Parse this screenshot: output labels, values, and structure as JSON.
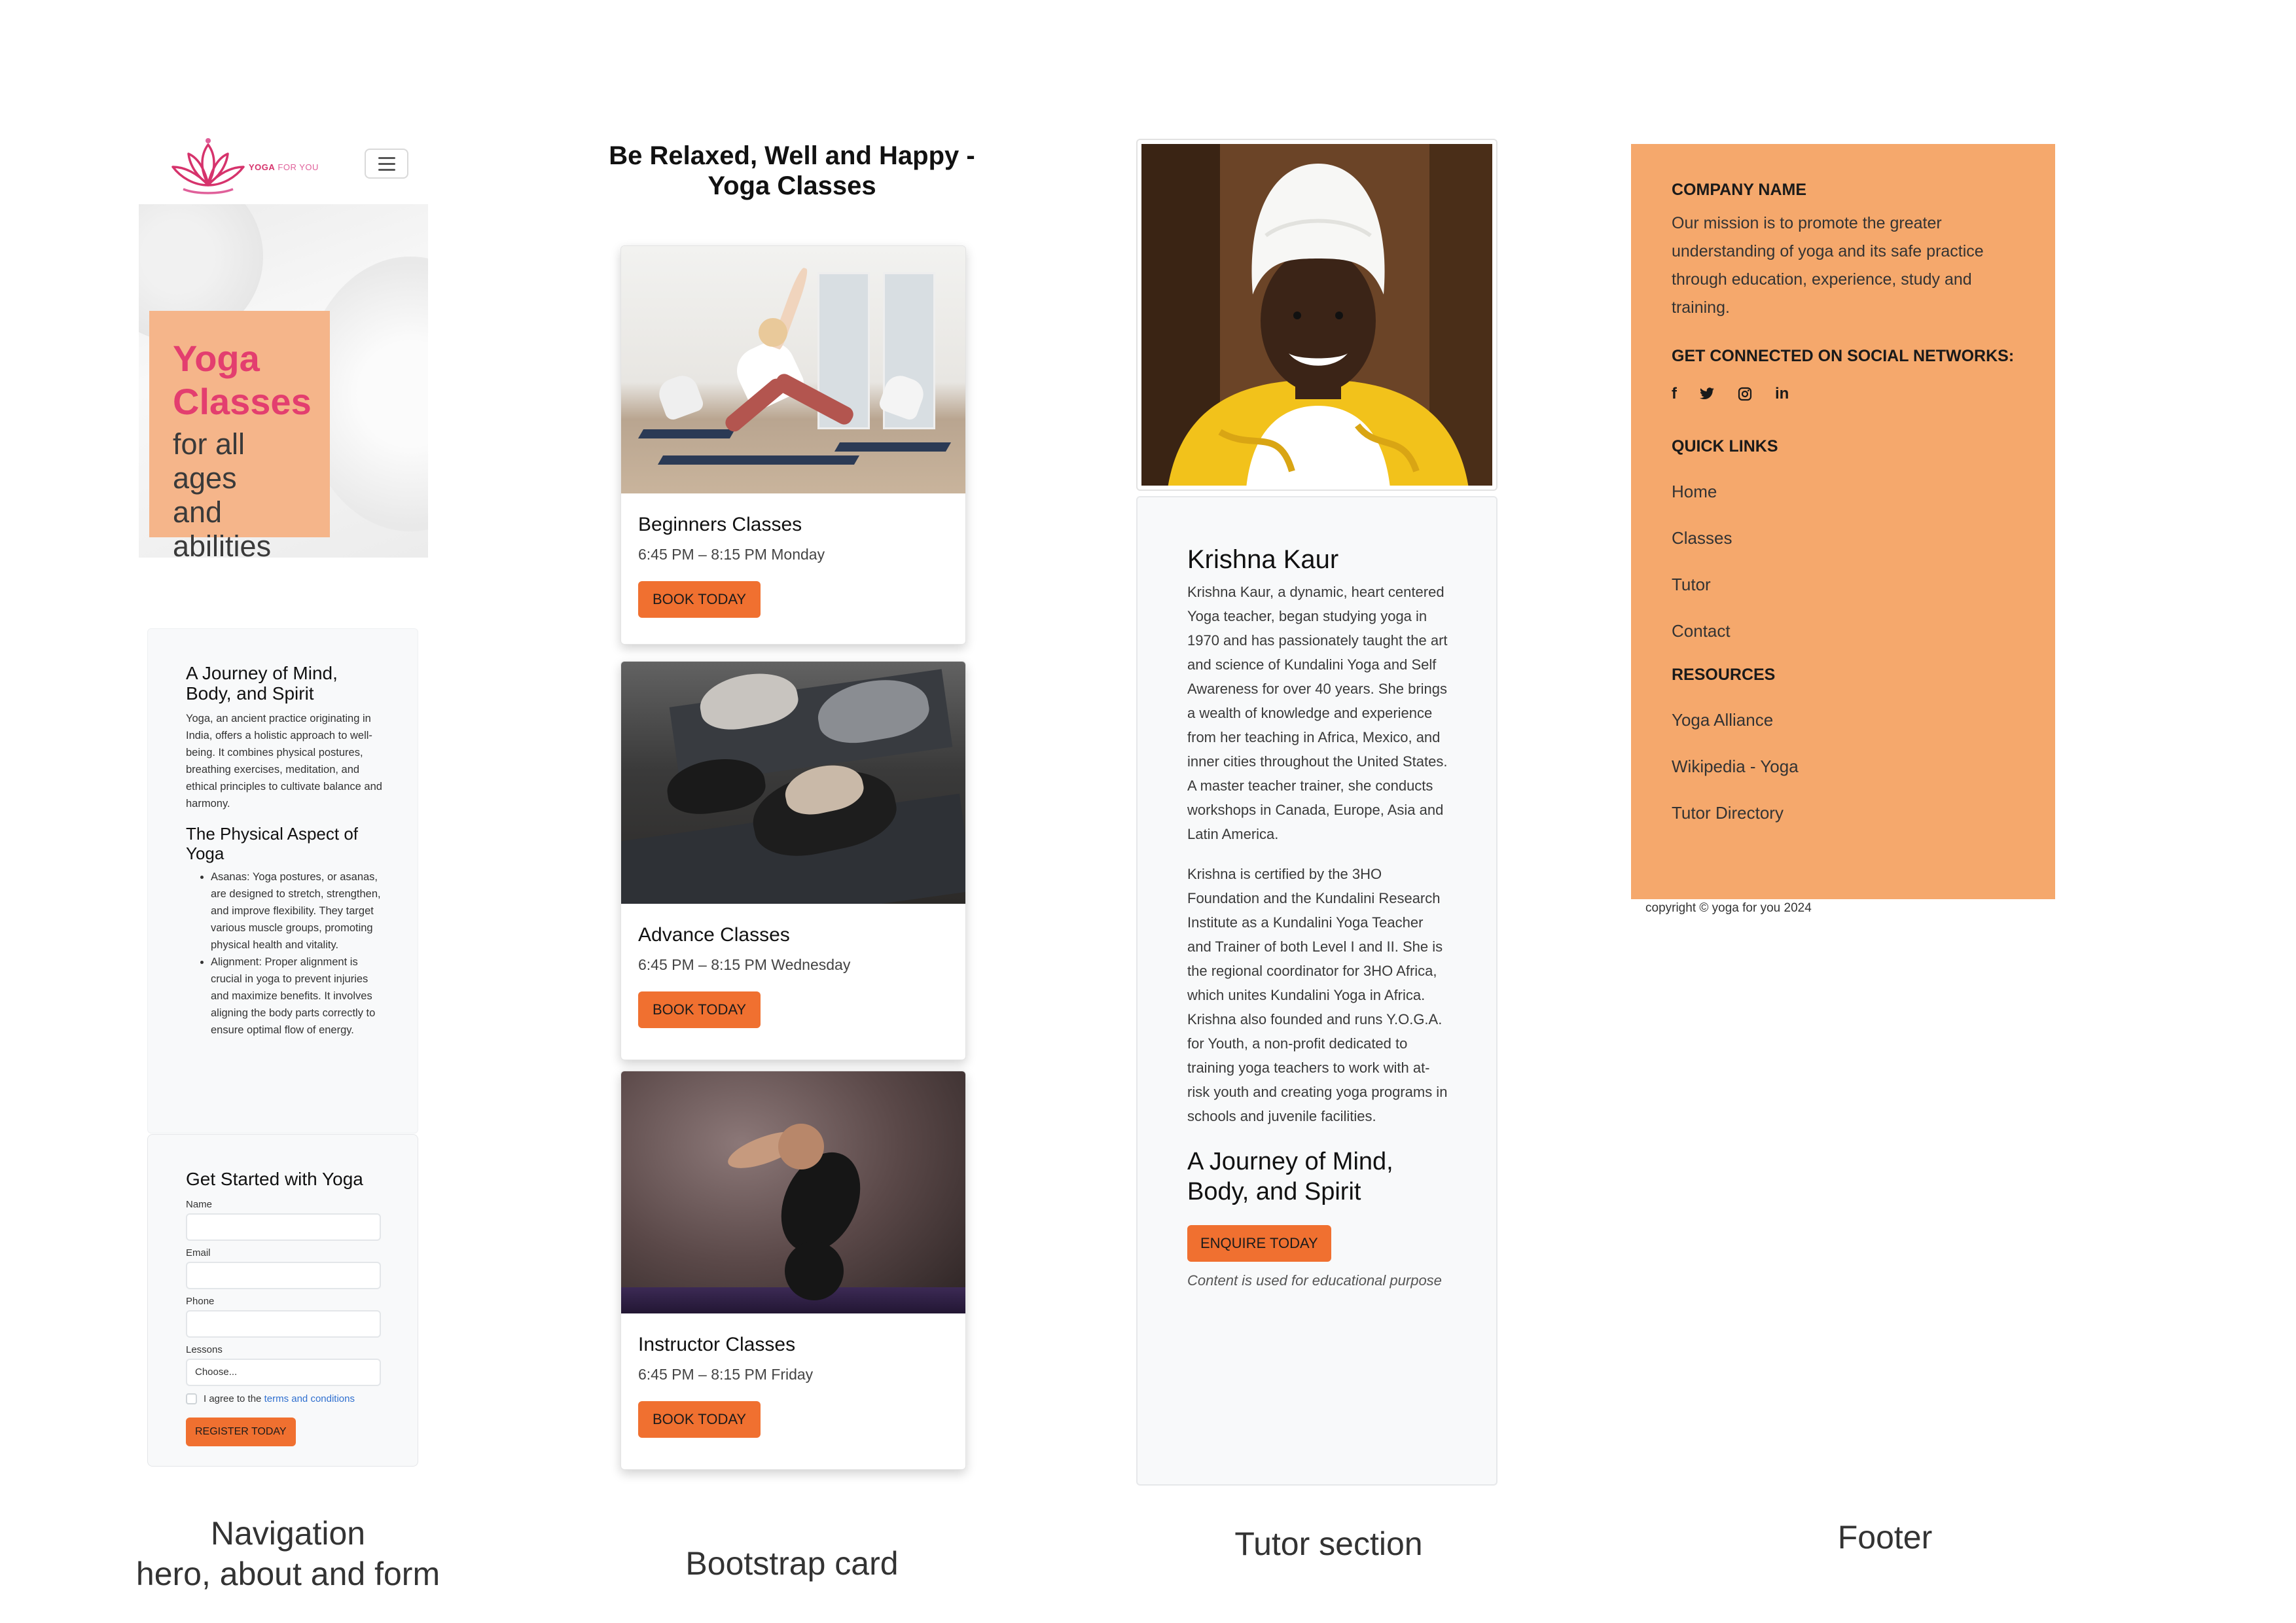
{
  "nav": {
    "logo_text": "YOGA",
    "logo_text_2": "FOR YOU",
    "toggler_icon": "hamburger-icon"
  },
  "hero": {
    "title_line1": "Yoga",
    "title_line2": "Classes",
    "subtitle_line1": "for all ages",
    "subtitle_line2": "and",
    "subtitle_line3": "abilities"
  },
  "about": {
    "heading": "A Journey of Mind, Body, and Spirit",
    "intro": "Yoga, an ancient practice originating in India, offers a holistic approach to well-being. It combines physical postures, breathing exercises, meditation, and ethical principles to cultivate balance and harmony.",
    "subheading": "The Physical Aspect of Yoga",
    "bullets": [
      "Asanas: Yoga postures, or asanas, are designed to stretch, strengthen, and improve flexibility. They target various muscle groups, promoting physical health and vitality.",
      "Alignment: Proper alignment is crucial in yoga to prevent injuries and maximize benefits. It involves aligning the body parts correctly to ensure optimal flow of energy."
    ]
  },
  "form": {
    "heading": "Get Started with Yoga",
    "name_label": "Name",
    "email_label": "Email",
    "phone_label": "Phone",
    "lessons_label": "Lessons",
    "lessons_selected": "Choose...",
    "agree_prefix": "I agree to the",
    "terms_link": "terms and conditions",
    "submit_label": "REGISTER TODAY"
  },
  "cards": {
    "heading": "Be Relaxed, Well and Happy - Yoga Classes",
    "button_label": "BOOK TODAY",
    "items": [
      {
        "title": "Beginners Classes",
        "time": "6:45 PM – 8:15 PM Monday"
      },
      {
        "title": "Advance Classes",
        "time": "6:45 PM – 8:15 PM Wednesday"
      },
      {
        "title": "Instructor Classes",
        "time": "6:45 PM – 8:15 PM Friday"
      }
    ]
  },
  "tutor": {
    "name": "Krishna Kaur",
    "bio_1": "Krishna Kaur, a dynamic, heart centered Yoga teacher, began studying yoga in 1970 and has passionately taught the art and science of Kundalini Yoga and Self Awareness for over 40 years. She brings a wealth of knowledge and experience from her teaching in Africa, Mexico, and inner cities throughout the United States. A master teacher trainer, she conducts workshops in Canada, Europe, Asia and Latin America.",
    "bio_2": "Krishna is certified by the 3HO Foundation and the Kundalini Research Institute as a Kundalini Yoga Teacher and Trainer of both Level I and II. She is the regional coordinator for 3HO Africa, which unites Kundalini Yoga in Africa. Krishna also founded and runs Y.O.G.A. for Youth, a non-profit dedicated to training yoga teachers to work with at-risk youth and creating yoga programs in schools and juvenile facilities.",
    "subheading": "A Journey of Mind, Body, and Spirit",
    "button_label": "ENQUIRE TODAY",
    "note": "Content is used for educational purpose"
  },
  "footer": {
    "company_heading": "COMPANY NAME",
    "mission": "Our mission is to promote the greater understanding of yoga and its safe practice through education, experience, study and training.",
    "social_heading": "GET CONNECTED ON SOCIAL NETWORKS:",
    "social_icons": [
      "facebook-icon",
      "twitter-icon",
      "instagram-icon",
      "linkedin-icon"
    ],
    "quick_links_heading": "QUICK LINKS",
    "quick_links": [
      "Home",
      "Classes",
      "Tutor",
      "Contact"
    ],
    "resources_heading": "RESOURCES",
    "resources": [
      "Yoga Alliance",
      "Wikipedia - Yoga",
      "Tutor Directory"
    ],
    "copyright": "copyright © yoga for you 2024"
  },
  "captions": {
    "col1_line1": "Navigation",
    "col1_line2": "hero, about and form",
    "col2": "Bootstrap card",
    "col3": "Tutor section",
    "col4": "Footer"
  },
  "colors": {
    "accent_orange": "#f07030",
    "hero_box": "#f5b58a",
    "hero_title": "#e33e6f",
    "footer_bg": "#f5a86c",
    "link_blue": "#2f6fcf"
  }
}
